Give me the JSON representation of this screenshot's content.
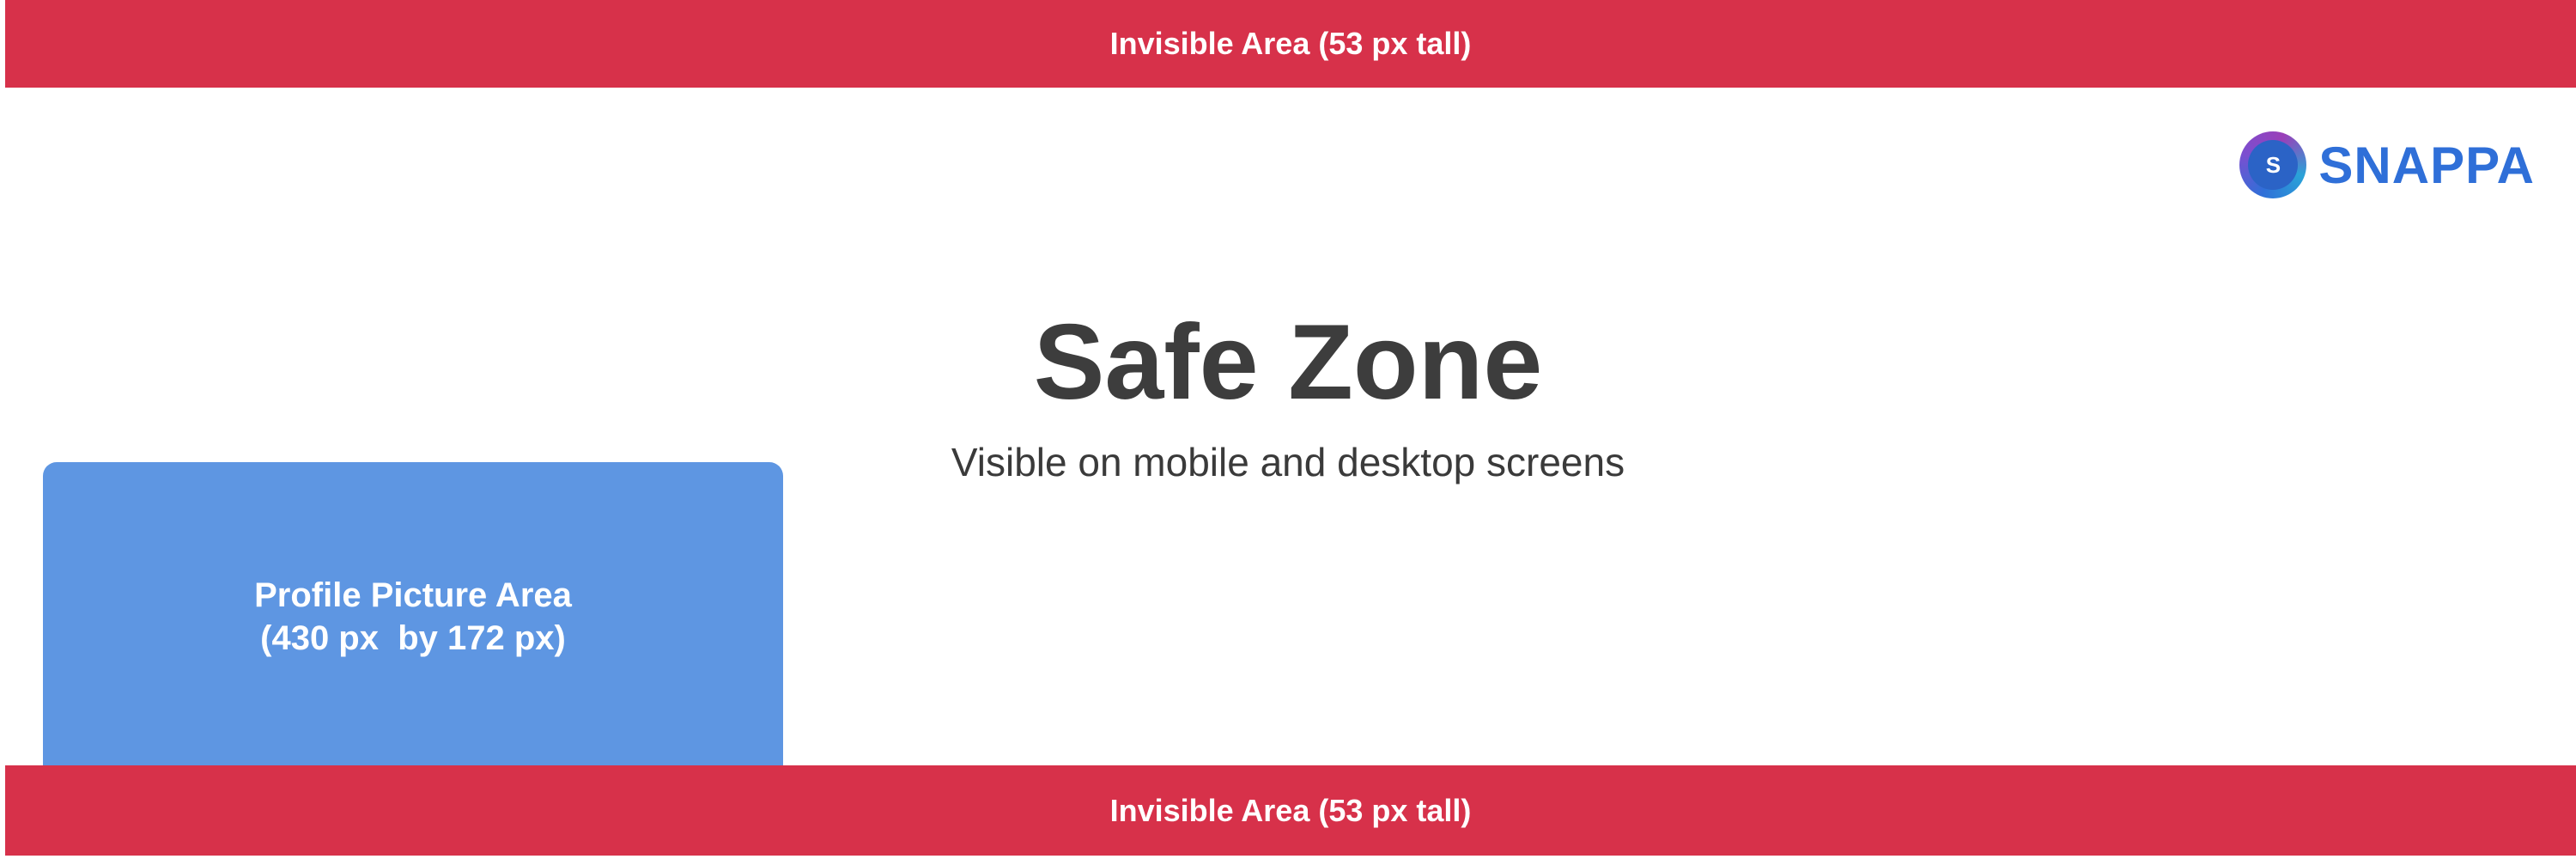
{
  "top_band": {
    "label": "Invisible Area (53 px tall)",
    "color": "#d7314a"
  },
  "bottom_band": {
    "label": "Invisible Area (53 px tall)",
    "color": "#d7314a"
  },
  "logo": {
    "letter": "S",
    "wordmark": "SNAPPA",
    "color": "#2f6fd8"
  },
  "safe_zone": {
    "title": "Safe Zone",
    "subtitle": "Visible on mobile and desktop screens"
  },
  "profile_area": {
    "title": "Profile Picture Area",
    "dimensions": "(430 px  by 172 px)",
    "color": "#5e96e2"
  }
}
